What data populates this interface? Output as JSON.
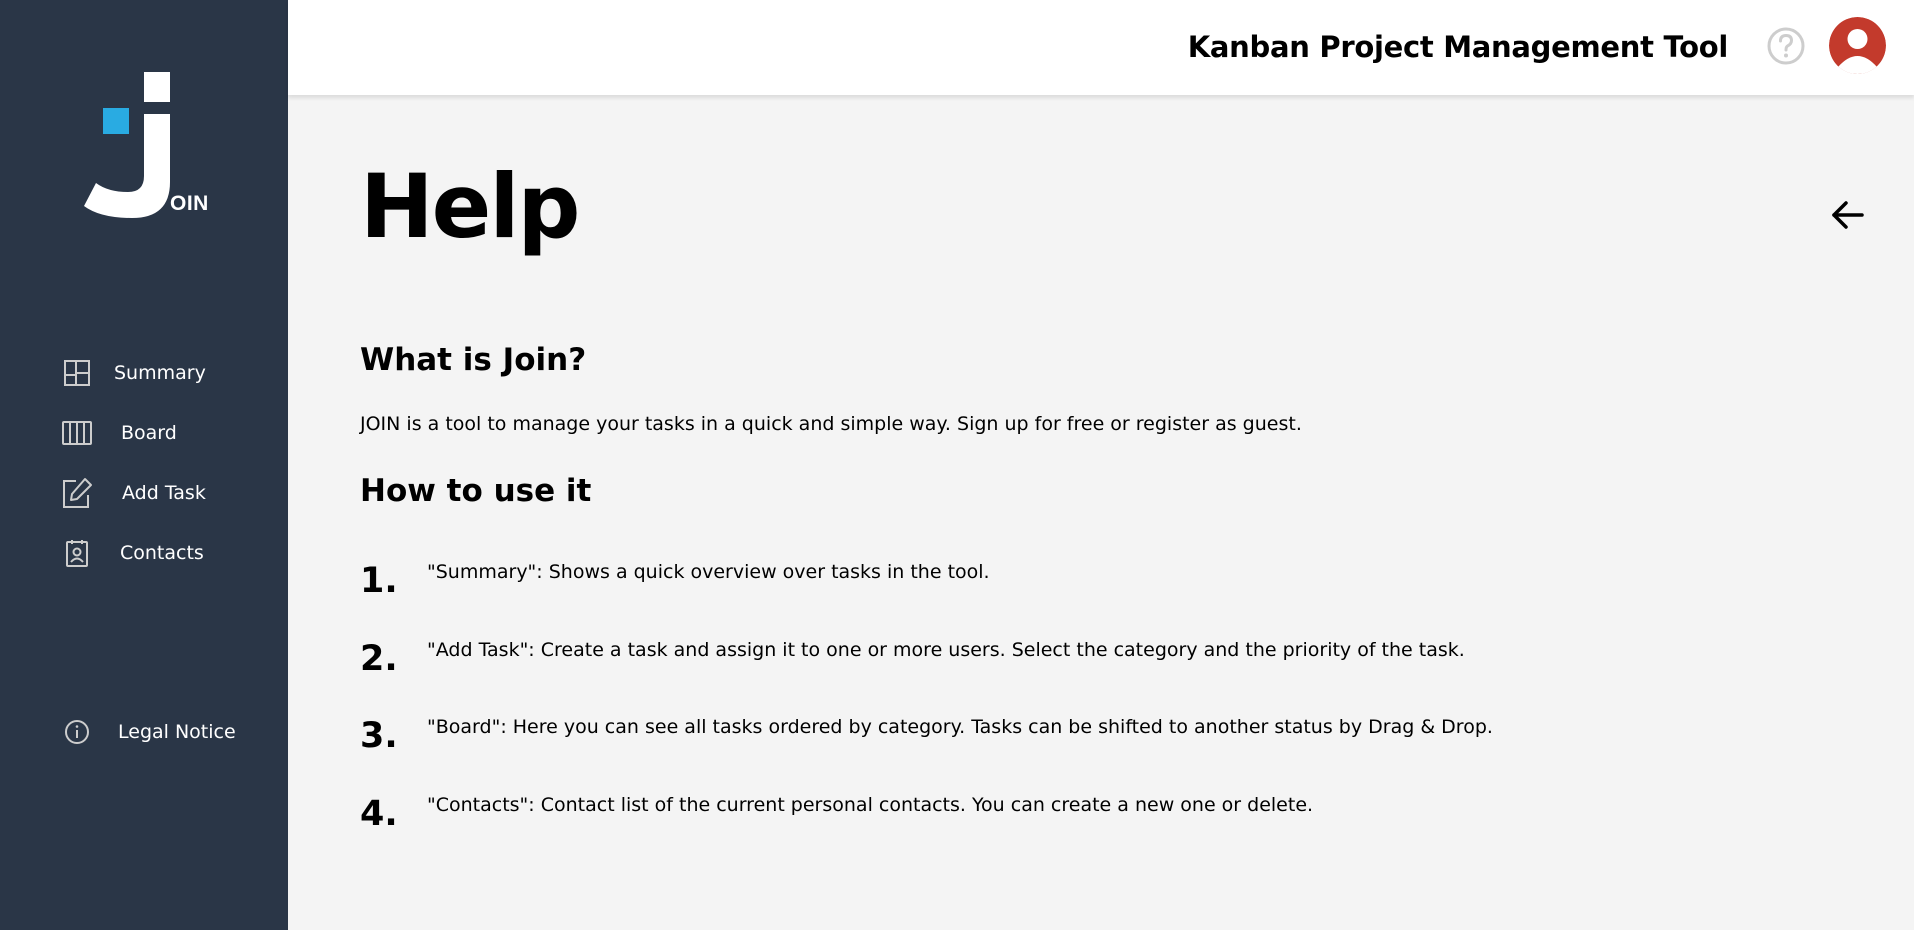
{
  "sidebar": {
    "logo_text": "OIN",
    "items": [
      {
        "label": "Summary",
        "icon": "summary-icon"
      },
      {
        "label": "Board",
        "icon": "board-icon"
      },
      {
        "label": "Add Task",
        "icon": "add-task-icon"
      },
      {
        "label": "Contacts",
        "icon": "contacts-icon"
      }
    ],
    "legal": {
      "label": "Legal Notice",
      "icon": "info-icon"
    }
  },
  "header": {
    "title": "Kanban Project Management Tool",
    "help_icon": "question-icon",
    "avatar_icon": "user-icon"
  },
  "main": {
    "title": "Help",
    "back_icon": "arrow-left-icon",
    "what_title": "What is Join?",
    "what_text": "JOIN is a tool to manage your tasks in a quick and simple way. Sign up for free or register as guest.",
    "how_title": "How to use it",
    "steps": [
      {
        "number": "1.",
        "text": "\"Summary\": Shows a quick overview over tasks in the tool."
      },
      {
        "number": "2.",
        "text": "\"Add Task\": Create a task and assign it to one or more users. Select the category and the priority of the task."
      },
      {
        "number": "3.",
        "text": "\"Board\": Here you can see all tasks ordered by category. Tasks can be shifted to another status by Drag & Drop."
      },
      {
        "number": "4.",
        "text": "\"Contacts\": Contact list of the current personal contacts. You can create a new one or delete."
      }
    ]
  },
  "colors": {
    "sidebar_bg": "#2a3647",
    "accent_blue": "#29abe2",
    "avatar_red": "#c33a2c",
    "page_bg": "#f4f4f4"
  }
}
